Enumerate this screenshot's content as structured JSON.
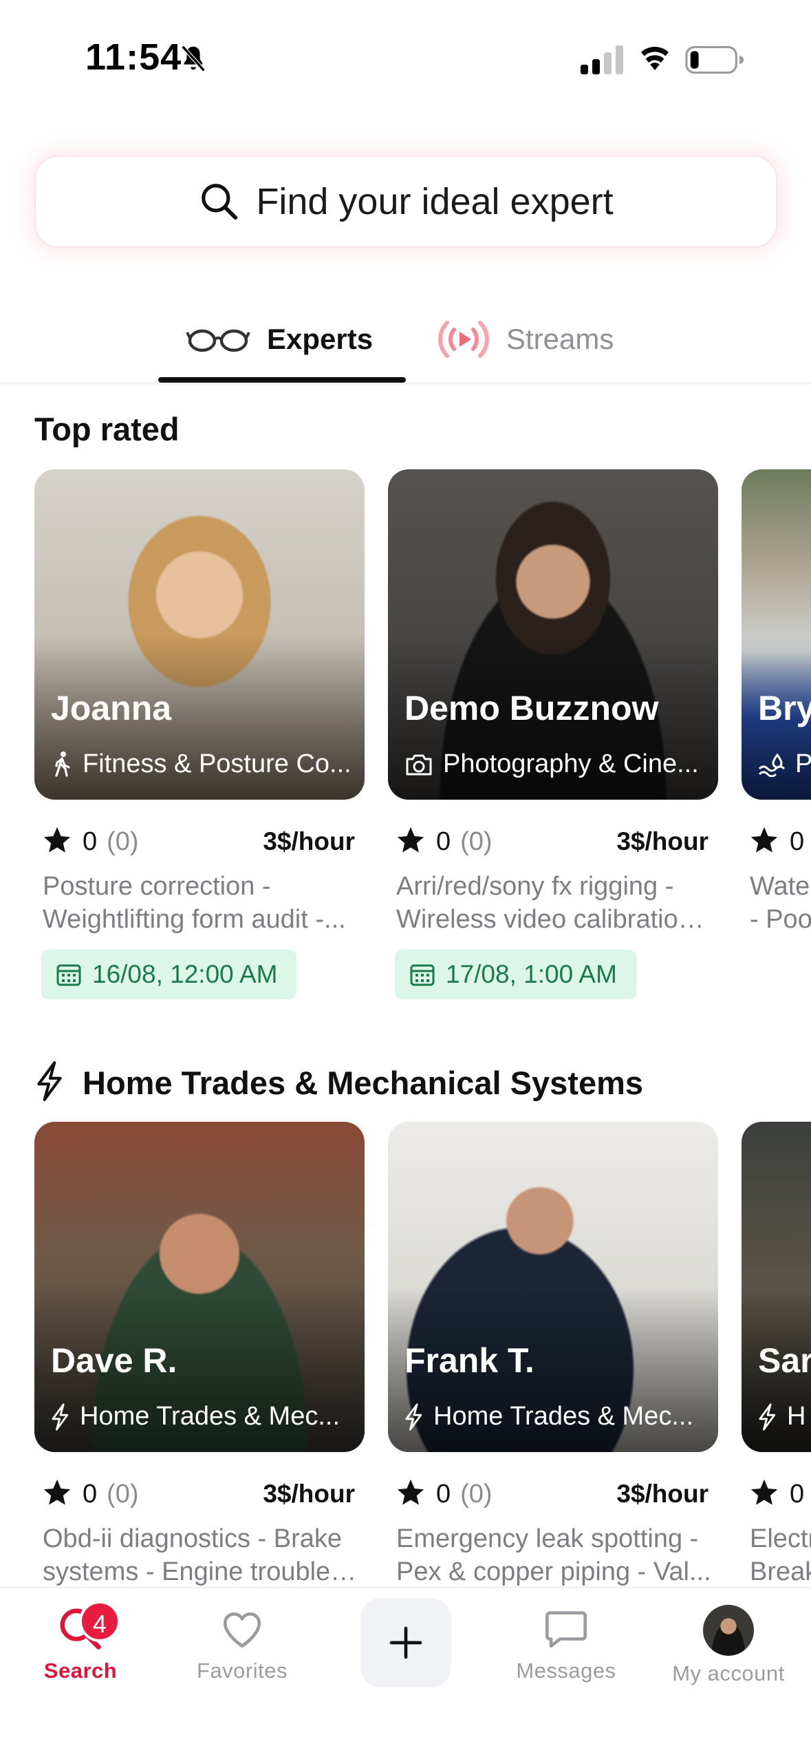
{
  "status_bar": {
    "time": "11:54"
  },
  "search": {
    "placeholder": "Find your ideal expert"
  },
  "tabs": [
    {
      "label": "Experts",
      "active": true
    },
    {
      "label": "Streams",
      "active": false
    }
  ],
  "sections": [
    {
      "title": "Top rated",
      "cards": [
        {
          "name": "Joanna",
          "category": "Fitness & Posture Co...",
          "category_icon": "walking-person-icon",
          "rating": "0",
          "reviews": "(0)",
          "price": "3$/hour",
          "desc_line1": "Posture correction -",
          "desc_line2": "Weightlifting form audit -...",
          "availability": "16/08, 12:00 AM"
        },
        {
          "name": "Demo Buzznow",
          "category": "Photography & Cine...",
          "category_icon": "camera-icon",
          "rating": "0",
          "reviews": "(0)",
          "price": "3$/hour",
          "desc_line1": "Arri/red/sony fx rigging -",
          "desc_line2": "Wireless video calibration...",
          "availability": "17/08, 1:00 AM"
        },
        {
          "name": "Bry",
          "category": "P",
          "category_icon": "water-icon",
          "rating": "0",
          "desc_line1": "Wate",
          "desc_line2": "- Poo"
        }
      ]
    },
    {
      "title": "Home Trades & Mechanical Systems",
      "title_icon": "lightning-icon",
      "cards": [
        {
          "name": "Dave R.",
          "category": "Home Trades & Mec...",
          "category_icon": "lightning-icon",
          "rating": "0",
          "reviews": "(0)",
          "price": "3$/hour",
          "desc_line1": "Obd-ii diagnostics - Brake",
          "desc_line2": "systems - Engine troubles..."
        },
        {
          "name": "Frank T.",
          "category": "Home Trades & Mec...",
          "category_icon": "lightning-icon",
          "rating": "0",
          "reviews": "(0)",
          "price": "3$/hour",
          "desc_line1": "Emergency leak spotting -",
          "desc_line2": "Pex & copper piping - Val..."
        },
        {
          "name": "Sar",
          "category": "H",
          "category_icon": "lightning-icon",
          "rating": "0",
          "desc_line1": "Electr",
          "desc_line2": "Break"
        }
      ]
    }
  ],
  "bottom_nav": {
    "search_label": "Search",
    "search_badge": "4",
    "favorites_label": "Favorites",
    "messages_label": "Messages",
    "account_label": "My account"
  },
  "colors": {
    "accent": "#e0133a",
    "availability_bg": "#dcf7e9",
    "availability_text": "#1a7a4c"
  }
}
